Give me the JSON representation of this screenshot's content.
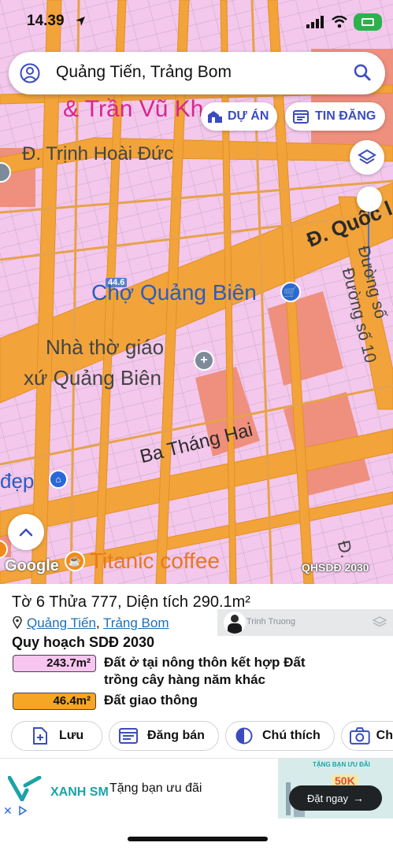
{
  "status_bar": {
    "time": "14.39"
  },
  "search": {
    "query": "Quảng Tiến, Trảng Bom"
  },
  "map_buttons": {
    "du_an": "DỰ ÁN",
    "tin_dang": "TIN ĐĂNG"
  },
  "map": {
    "labels": {
      "top_cut": "& Trần Vũ Kh",
      "street_trinh_hoai_duc": "Đ. Trịnh Hoài Đức",
      "street_quoc": "Đ. Quốc l",
      "street_so10_a": "Đường số",
      "street_so10_b": "Đường số 10",
      "cho_quang_bien": "Chợ Quảng Biên",
      "nha_tho_line1": "Nhà thờ giáo",
      "nha_tho_line2": "xứ Quảng Biên",
      "ba_thang_hai": "Ba Tháng Hai",
      "dep": "đẹp",
      "titanic": "Titanic coffee",
      "road_shield": "44.6",
      "google": "Google",
      "layer_tag": "QHSDĐ 2030",
      "right_bottom": "Đ."
    }
  },
  "parcel": {
    "title": "Tờ 6 Thửa 777, Diện tích 290.1m²",
    "commune": "Quảng Tiến",
    "district": "Trảng Bom",
    "separator": ", ",
    "plan_title": "Quy hoạch SDĐ 2030",
    "land_uses": [
      {
        "area": "243.7m²",
        "line1": "Đất ở tại nông thôn kết hợp Đất",
        "line2": "trồng cây hàng năm khác",
        "color": "#f7c5f0"
      },
      {
        "area": "46.4m²",
        "line1": "Đất giao thông",
        "line2": "",
        "color": "#f5a623"
      }
    ]
  },
  "user": {
    "name": "Trinh Truong"
  },
  "actions": {
    "save": "Lưu",
    "post": "Đăng bán",
    "legend": "Chú thích",
    "camera": "Ch"
  },
  "ad": {
    "brand": "XANH SM",
    "tagline": "Tặng bạn ưu đãi",
    "banner_title": "TẶNG BẠN ƯU ĐÃI",
    "banner_amount": "50K",
    "cta": "Đặt ngay"
  },
  "colors": {
    "accent": "#3b4cc0",
    "road": "#f2a33a",
    "land": "#f3c8ec",
    "link": "#1f6fb5"
  }
}
